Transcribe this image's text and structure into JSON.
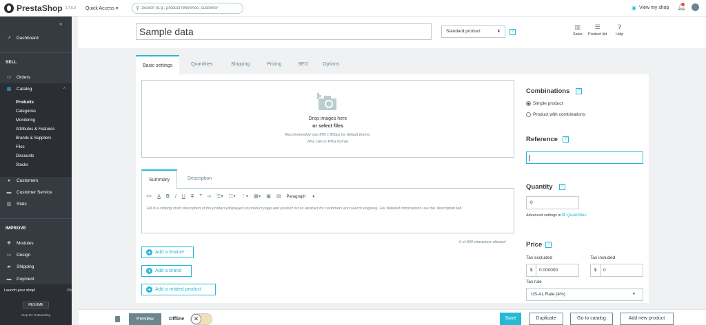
{
  "topbar": {
    "brand": "PrestaShop",
    "version": "1.7.6.0",
    "quick_access": "Quick Access ▾",
    "search_placeholder": "Search (e.g.: product reference, customer",
    "view_shop": "View my shop"
  },
  "sidebar": {
    "dashboard": "Dashboard",
    "sell": "SELL",
    "orders": "Orders",
    "catalog": "Catalog",
    "catalog_sub": [
      "Products",
      "Categories",
      "Monitoring",
      "Attributes & Features",
      "Brands & Suppliers",
      "Files",
      "Discounts",
      "Stocks"
    ],
    "customers": "Customers",
    "customer_service": "Customer Service",
    "stats": "Stats",
    "improve": "IMPROVE",
    "modules": "Modules",
    "design": "Design",
    "shipping": "Shipping",
    "payment": "Payment",
    "launch": "Launch your shop!",
    "launch_pct": "0%",
    "resume": "RESUME",
    "stop": "Stop the OnBoarding"
  },
  "header": {
    "product_name": "Sample data",
    "product_type": "Standard product",
    "sales": "Sales",
    "product_list": "Product list",
    "help": "Help"
  },
  "tabs": [
    "Basic settings",
    "Quantities",
    "Shipping",
    "Pricing",
    "SEO",
    "Options"
  ],
  "dropzone": {
    "line1": "Drop images here",
    "line2": "or select files",
    "line3": "Recommended size 800 x 800px for default theme.",
    "line4": "JPG, GIF or PNG format."
  },
  "summary_tabs": [
    "Summary",
    "Description"
  ],
  "editor": {
    "paragraph": "Paragraph",
    "placeholder": "Fill in a striking short description of the product (displayed on product page and product list as abstract for customers and search engines). For detailed informations use the 'description tab.'",
    "counter": "0 of 800 characters allowed"
  },
  "buttons": {
    "add_feature": "Add a feature",
    "add_brand": "Add a brand",
    "add_related": "Add a related product"
  },
  "right": {
    "combinations": "Combinations",
    "simple": "Simple product",
    "with_combinations": "Product with combinations",
    "reference": "Reference",
    "quantity": "Quantity",
    "quantity_value": "0",
    "advanced": "Advanced settings in",
    "quantities_link": "Quantities",
    "price": "Price",
    "tax_excluded": "Tax excluded",
    "tax_included": "Tax included",
    "currency": "$",
    "price_excl": "0.000000",
    "price_incl": "0",
    "tax_rule": "Tax rule",
    "tax_rule_value": "US-AL Rate (4%)"
  },
  "footer": {
    "preview": "Preview",
    "offline": "Offline",
    "save": "Save",
    "duplicate": "Duplicate",
    "go_to_catalog": "Go to catalog",
    "add_new": "Add new product"
  },
  "colors": {
    "accent": "#25b9d7",
    "sidebar": "#363a41"
  }
}
